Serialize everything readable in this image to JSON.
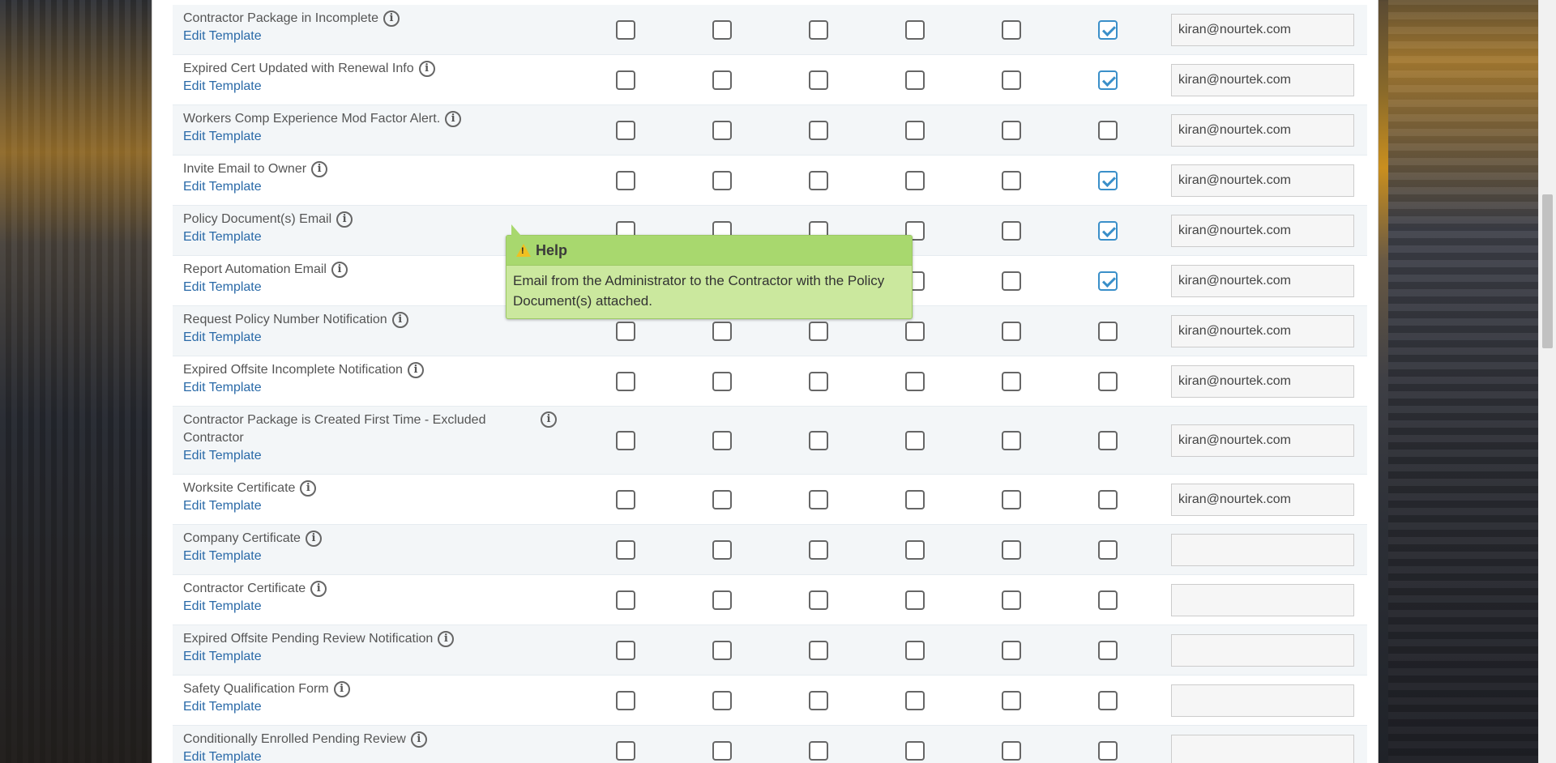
{
  "rows": [
    {
      "name": "Contractor Package in Incomplete",
      "edit": "Edit Template",
      "checked": [
        false,
        false,
        false,
        false,
        false,
        true
      ],
      "email": "kiran@nourtek.com"
    },
    {
      "name": "Expired Cert Updated with Renewal Info",
      "edit": "Edit Template",
      "checked": [
        false,
        false,
        false,
        false,
        false,
        true
      ],
      "email": "kiran@nourtek.com"
    },
    {
      "name": "Workers Comp Experience Mod Factor Alert.",
      "edit": "Edit Template",
      "checked": [
        false,
        false,
        false,
        false,
        false,
        false
      ],
      "email": "kiran@nourtek.com"
    },
    {
      "name": "Invite Email to Owner",
      "edit": "Edit Template",
      "checked": [
        false,
        false,
        false,
        false,
        false,
        true
      ],
      "email": "kiran@nourtek.com"
    },
    {
      "name": "Policy Document(s) Email",
      "edit": "Edit Template",
      "checked": [
        false,
        false,
        false,
        false,
        false,
        true
      ],
      "email": "kiran@nourtek.com"
    },
    {
      "name": "Report Automation Email",
      "edit": "Edit Template",
      "checked": [
        false,
        false,
        false,
        false,
        false,
        true
      ],
      "email": "kiran@nourtek.com"
    },
    {
      "name": "Request Policy Number Notification",
      "edit": "Edit Template",
      "checked": [
        false,
        false,
        false,
        false,
        false,
        false
      ],
      "email": "kiran@nourtek.com"
    },
    {
      "name": "Expired Offsite Incomplete Notification",
      "edit": "Edit Template",
      "checked": [
        false,
        false,
        false,
        false,
        false,
        false
      ],
      "email": "kiran@nourtek.com"
    },
    {
      "name": "Contractor Package is Created First Time - Excluded Contractor",
      "edit": "Edit Template",
      "checked": [
        false,
        false,
        false,
        false,
        false,
        false
      ],
      "email": "kiran@nourtek.com"
    },
    {
      "name": "Worksite Certificate",
      "edit": "Edit Template",
      "checked": [
        false,
        false,
        false,
        false,
        false,
        false
      ],
      "email": "kiran@nourtek.com"
    },
    {
      "name": "Company Certificate",
      "edit": "Edit Template",
      "checked": [
        false,
        false,
        false,
        false,
        false,
        false
      ],
      "email": ""
    },
    {
      "name": "Contractor Certificate",
      "edit": "Edit Template",
      "checked": [
        false,
        false,
        false,
        false,
        false,
        false
      ],
      "email": ""
    },
    {
      "name": "Expired Offsite Pending Review Notification",
      "edit": "Edit Template",
      "checked": [
        false,
        false,
        false,
        false,
        false,
        false
      ],
      "email": ""
    },
    {
      "name": "Safety Qualification Form",
      "edit": "Edit Template",
      "checked": [
        false,
        false,
        false,
        false,
        false,
        false
      ],
      "email": ""
    },
    {
      "name": "Conditionally Enrolled Pending Review",
      "edit": "Edit Template",
      "checked": [
        false,
        false,
        false,
        false,
        false,
        false
      ],
      "email": ""
    }
  ],
  "tooltip": {
    "title": "Help",
    "body": "Email from the Administrator to the Contractor with the Policy Document(s) attached."
  },
  "info_glyph": "i"
}
